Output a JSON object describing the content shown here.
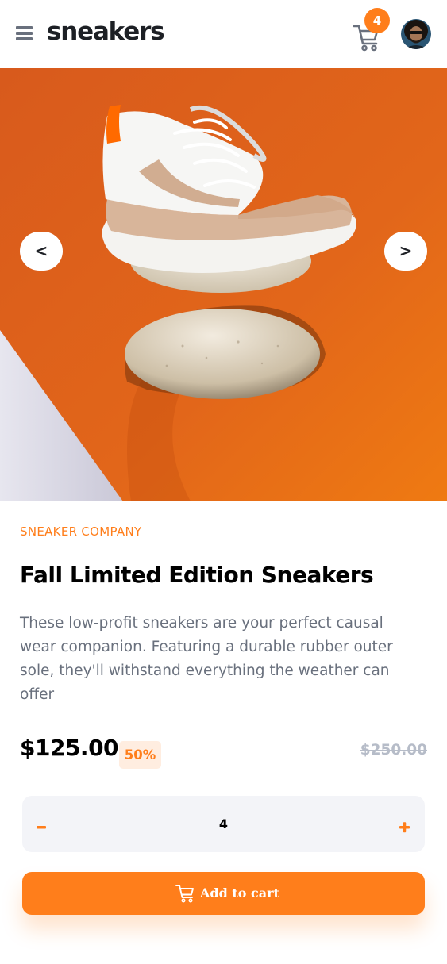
{
  "header": {
    "logo": "sneakers",
    "cart_count": "4"
  },
  "gallery": {
    "prev_label": "<",
    "next_label": ">"
  },
  "product": {
    "company": "SNEAKER COMPANY",
    "title": "Fall Limited Edition Sneakers",
    "description": "These low-profit sneakers are your perfect causal wear companion. Featuring a durable rubber outer sole, they'll withstand everything the weather can offer",
    "price": "$125.00",
    "discount": "50%",
    "original_price": "$250.00"
  },
  "quantity": {
    "value": "4",
    "minus_icon": "minus-icon",
    "plus_icon": "plus-icon"
  },
  "add_to_cart": {
    "label": "Add to cart",
    "icon": "cart-icon"
  },
  "colors": {
    "accent": "#ff7e1b",
    "accent_pale": "#ffede0",
    "dark": "#1d2025",
    "grayish_blue": "#69707d",
    "light_gray": "#f3f4f8"
  }
}
